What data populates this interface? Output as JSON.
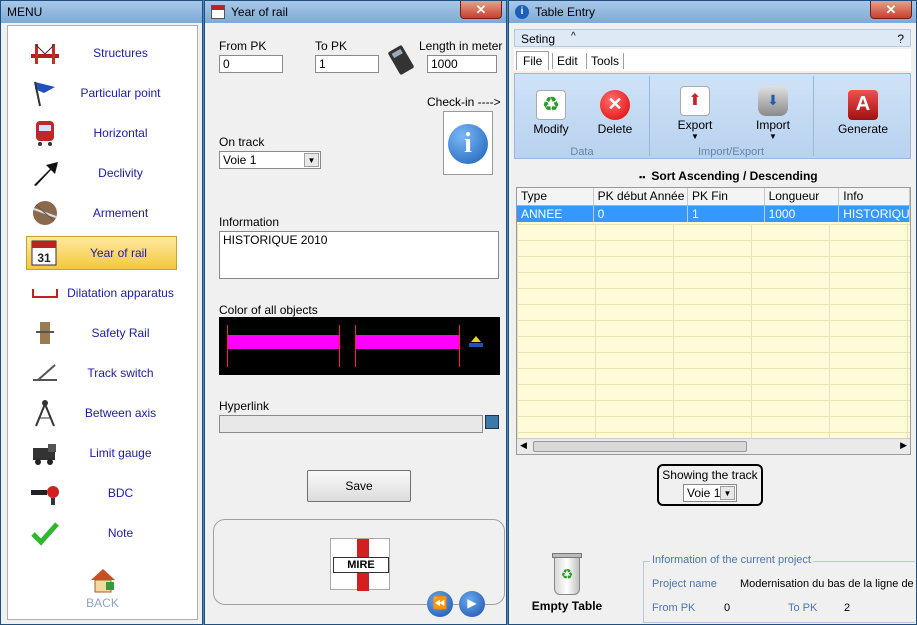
{
  "menu": {
    "title": "MENU",
    "items": [
      {
        "label": "Structures",
        "icon": "bridge-icon"
      },
      {
        "label": "Particular point",
        "icon": "flag-icon"
      },
      {
        "label": "Horizontal",
        "icon": "train-icon"
      },
      {
        "label": "Declivity",
        "icon": "arrow-icon"
      },
      {
        "label": "Armement",
        "icon": "rails-icon"
      },
      {
        "label": "Year of rail",
        "icon": "calendar-icon"
      },
      {
        "label": "Dilatation apparatus",
        "icon": "dilatation-icon"
      },
      {
        "label": "Safety Rail",
        "icon": "safety-rail-icon"
      },
      {
        "label": "Track switch",
        "icon": "switch-icon"
      },
      {
        "label": "Between axis",
        "icon": "compass-icon"
      },
      {
        "label": "Limit gauge",
        "icon": "locomotive-icon"
      },
      {
        "label": "BDC",
        "icon": "signal-icon"
      },
      {
        "label": "Note",
        "icon": "check-icon"
      }
    ],
    "back_label": "BACK"
  },
  "year": {
    "title": "Year of rail",
    "from_pk_label": "From PK",
    "from_pk_value": "0",
    "to_pk_label": "To PK",
    "to_pk_value": "1",
    "length_label": "Length in meter",
    "length_value": "1000",
    "checkin_label": "Check-in ---->",
    "on_track_label": "On track",
    "on_track_value": "Voie 1",
    "information_label": "Information",
    "information_value": "HISTORIQUE 2010",
    "color_label": "Color of all objects",
    "hyperlink_label": "Hyperlink",
    "save_label": "Save",
    "logo_text": "MIRE",
    "accent_color": "#ff00ff"
  },
  "table": {
    "title": "Table Entry",
    "menu_seting": "Seting",
    "menu_help": "?",
    "tabs": [
      "File",
      "Edit",
      "Tools"
    ],
    "buttons": {
      "modify": "Modify",
      "delete": "Delete",
      "export": "Export",
      "import": "Import",
      "generate": "Generate"
    },
    "groups": {
      "data": "Data",
      "import_export": "Import/Export"
    },
    "sort_label": "Sort Ascending / Descending",
    "columns": [
      "Type",
      "PK début Année",
      "PK Fin",
      "Longueur",
      "Info"
    ],
    "rows": [
      [
        "ANNEE",
        "0",
        "1",
        "1000",
        "HISTORIQUE"
      ]
    ],
    "showing_label": "Showing the track",
    "showing_value": "Voie 1",
    "empty_table_label": "Empty Table",
    "project_info_title": "Information of the current project",
    "project_name_label": "Project name",
    "project_name_value": "Modernisation du bas de la ligne de",
    "from_pk_label": "From PK",
    "from_pk_value": "0",
    "to_pk_label": "To PK",
    "to_pk_value": "2"
  }
}
